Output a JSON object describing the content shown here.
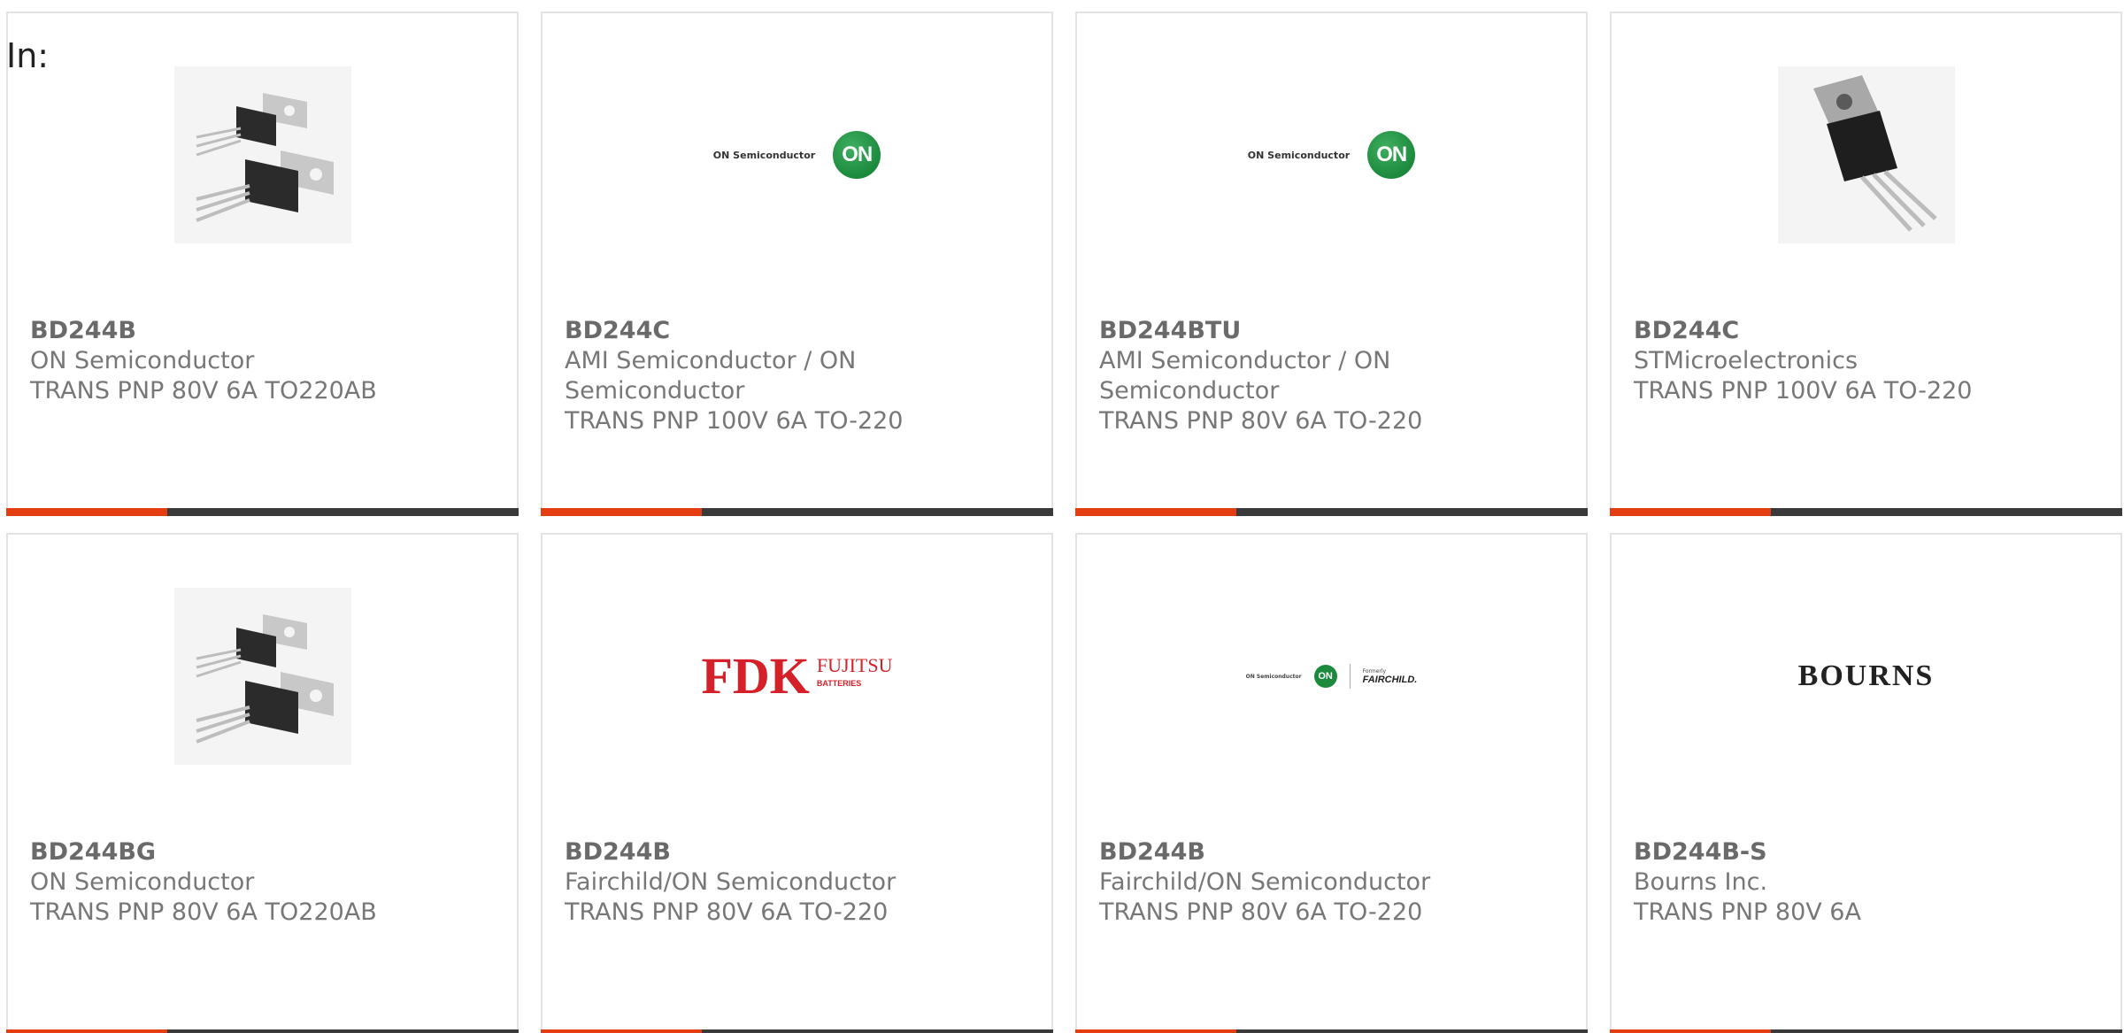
{
  "filter_label": "In:",
  "colors": {
    "accent": "#e43d12",
    "bar": "#3a3a3a",
    "part_number": "#6a6a6a",
    "text": "#777777",
    "on_green": "#1c8a3c",
    "fdk_red": "#d32029"
  },
  "cards": [
    {
      "part_number": "BD244B",
      "manufacturer": "ON Semiconductor",
      "description": "TRANS PNP 80V 6A TO220AB",
      "image": "transistor-pair-photo"
    },
    {
      "part_number": "BD244C",
      "manufacturer": "AMI Semiconductor / ON Semiconductor",
      "description": "TRANS PNP 100V 6A TO-220",
      "image": "on-semiconductor-logo",
      "logo_text": "ON Semiconductor",
      "logo_mark": "ON"
    },
    {
      "part_number": "BD244BTU",
      "manufacturer": "AMI Semiconductor / ON Semiconductor",
      "description": "TRANS PNP 80V 6A TO-220",
      "image": "on-semiconductor-logo",
      "logo_text": "ON Semiconductor",
      "logo_mark": "ON"
    },
    {
      "part_number": "BD244C",
      "manufacturer": "STMicroelectronics",
      "description": "TRANS PNP 100V 6A TO-220",
      "image": "transistor-single-photo"
    },
    {
      "part_number": "BD244BG",
      "manufacturer": "ON Semiconductor",
      "description": "TRANS PNP 80V 6A TO220AB",
      "image": "transistor-pair-photo"
    },
    {
      "part_number": "BD244B",
      "manufacturer": "Fairchild/ON Semiconductor",
      "description": "TRANS PNP 80V 6A TO-220",
      "image": "fdk-fujitsu-logo",
      "logo_main": "FDK",
      "logo_sub": "FUJITSU",
      "logo_small": "BATTERIES"
    },
    {
      "part_number": "BD244B",
      "manufacturer": "Fairchild/ON Semiconductor",
      "description": "TRANS PNP 80V 6A TO-220",
      "image": "on-fairchild-logo",
      "logo_text": "ON Semiconductor",
      "logo_mark": "ON",
      "logo_formerly": "Formerly",
      "logo_name": "FAIRCHILD."
    },
    {
      "part_number": "BD244B-S",
      "manufacturer": "Bourns Inc.",
      "description": "TRANS PNP 80V 6A",
      "image": "bourns-logo",
      "logo_text": "BOURNS"
    }
  ]
}
